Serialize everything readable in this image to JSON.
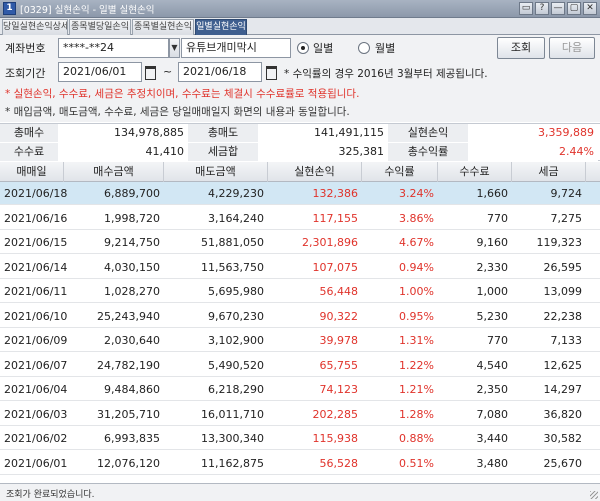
{
  "window": {
    "title": "[0329] 실현손익 - 일별 실현손익",
    "app_icon": "1",
    "buttons": [
      "▭",
      "?",
      "—",
      "▢",
      "✕"
    ]
  },
  "tabs": [
    {
      "label": "당일실현손익상세",
      "active": false
    },
    {
      "label": "종목별당일손익",
      "active": false
    },
    {
      "label": "종목별실현손익",
      "active": false
    },
    {
      "label": "일별실현손익",
      "active": true
    }
  ],
  "form": {
    "account_label": "계좌번호",
    "account_value": "****-**24",
    "account_name": "유튜브개미막시",
    "radio_daily": "일별",
    "radio_monthly": "월별",
    "period_label": "조회기간",
    "date_from": "2021/06/01",
    "tilde": "~",
    "date_to": "2021/06/18",
    "note_period": "* 수익률의 경우 2016년 3월부터 제공됩니다.",
    "query_button": "조회",
    "next_button": "다음",
    "note_red": "* 실현손익, 수수료, 세금은 추정치이며, 수수료는 체결시 수수료률로 적용됩니다.",
    "note_gray": "* 매입금액, 매도금액, 수수료, 세금은 당일매매일지 화면의 내용과 동일합니다."
  },
  "summary": {
    "total_buy_label": "총매수",
    "total_buy": "134,978,885",
    "total_sell_label": "총매도",
    "total_sell": "141,491,115",
    "realized_label": "실현손익",
    "realized": "3,359,889",
    "fee_label": "수수료",
    "fee": "41,410",
    "tax_label": "세금합",
    "tax": "325,381",
    "return_label": "총수익률",
    "return": "2.44%"
  },
  "table": {
    "columns": [
      "매매일",
      "매수금액",
      "매도금액",
      "실현손익",
      "수익률",
      "수수료",
      "세금"
    ],
    "rows": [
      [
        "2021/06/18",
        "6,889,700",
        "4,229,230",
        "132,386",
        "3.24%",
        "1,660",
        "9,724"
      ],
      [
        "2021/06/16",
        "1,998,720",
        "3,164,240",
        "117,155",
        "3.86%",
        "770",
        "7,275"
      ],
      [
        "2021/06/15",
        "9,214,750",
        "51,881,050",
        "2,301,896",
        "4.67%",
        "9,160",
        "119,323"
      ],
      [
        "2021/06/14",
        "4,030,150",
        "11,563,750",
        "107,075",
        "0.94%",
        "2,330",
        "26,595"
      ],
      [
        "2021/06/11",
        "1,028,270",
        "5,695,980",
        "56,448",
        "1.00%",
        "1,000",
        "13,099"
      ],
      [
        "2021/06/10",
        "25,243,940",
        "9,670,230",
        "90,322",
        "0.95%",
        "5,230",
        "22,238"
      ],
      [
        "2021/06/09",
        "2,030,640",
        "3,102,900",
        "39,978",
        "1.31%",
        "770",
        "7,133"
      ],
      [
        "2021/06/07",
        "24,782,190",
        "5,490,520",
        "65,755",
        "1.22%",
        "4,540",
        "12,625"
      ],
      [
        "2021/06/04",
        "9,484,860",
        "6,218,290",
        "74,123",
        "1.21%",
        "2,350",
        "14,297"
      ],
      [
        "2021/06/03",
        "31,205,710",
        "16,011,710",
        "202,285",
        "1.28%",
        "7,080",
        "36,820"
      ],
      [
        "2021/06/02",
        "6,993,835",
        "13,300,340",
        "115,938",
        "0.88%",
        "3,440",
        "30,582"
      ],
      [
        "2021/06/01",
        "12,076,120",
        "11,162,875",
        "56,528",
        "0.51%",
        "3,480",
        "25,670"
      ]
    ]
  },
  "status": {
    "text": "조회가 완료되었습니다."
  },
  "colors": {
    "profit": "#e0332b",
    "selected_row": "#d2e7f4",
    "active_tab": "#3f5f8f"
  }
}
